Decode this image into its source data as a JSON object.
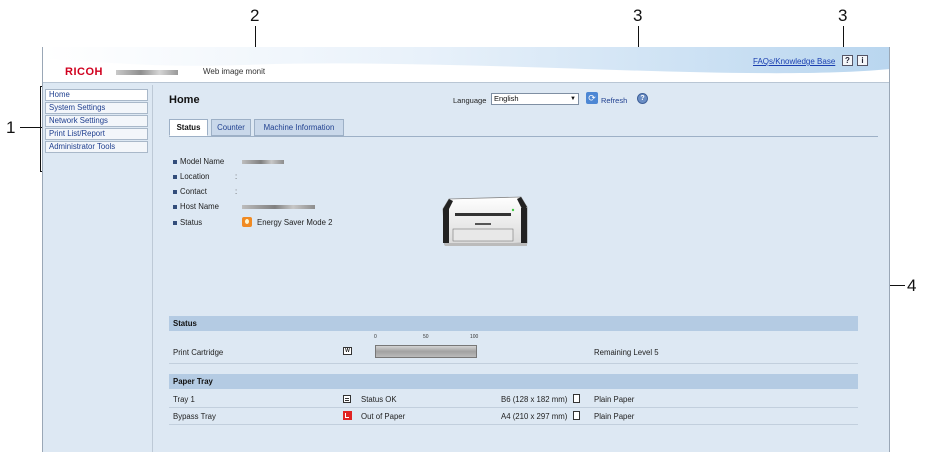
{
  "callouts": [
    "1",
    "2",
    "3",
    "3",
    "4"
  ],
  "header": {
    "brand": "RICOH",
    "app_title": "Web image monit",
    "faq_link": "FAQs/Knowledge Base",
    "help_icon_glyph": "?",
    "info_icon_glyph": "i"
  },
  "sidebar": {
    "items": [
      {
        "label": "Home"
      },
      {
        "label": "System Settings"
      },
      {
        "label": "Network Settings"
      },
      {
        "label": "Print List/Report"
      },
      {
        "label": "Administrator Tools"
      }
    ]
  },
  "main": {
    "title": "Home",
    "language_label": "Language",
    "language_value": "English",
    "refresh_label": "Refresh",
    "help_glyph": "?",
    "tabs": [
      {
        "label": "Status"
      },
      {
        "label": "Counter"
      },
      {
        "label": "Machine Information"
      }
    ],
    "info": {
      "model_name_label": "Model Name",
      "location_label": "Location",
      "location_value": ":",
      "contact_label": "Contact",
      "contact_value": ":",
      "host_name_label": "Host Name",
      "status_label": "Status",
      "status_value": "Energy Saver Mode 2"
    },
    "status_section": {
      "heading": "Status",
      "scale": [
        "0",
        "50",
        "100"
      ],
      "cartridge_label": "Print Cartridge",
      "cartridge_icon_glyph": "W",
      "cartridge_level_fraction": 1.0,
      "remaining": "Remaining Level 5"
    },
    "paper_section": {
      "heading": "Paper Tray",
      "rows": [
        {
          "name": "Tray 1",
          "status": "Status OK",
          "size": "B6 (128 x 182 mm)",
          "type": "Plain Paper"
        },
        {
          "name": "Bypass Tray",
          "status": "Out of Paper",
          "size": "A4 (210 x 297 mm)",
          "type": "Plain Paper"
        }
      ]
    }
  },
  "colors": {
    "brand_red": "#d0001e",
    "link_blue": "#1f3f8f",
    "panel_bg": "#dde8f3",
    "section_bar": "#b4cbe3",
    "error_red": "#e02424",
    "energy_orange": "#f08a23"
  }
}
